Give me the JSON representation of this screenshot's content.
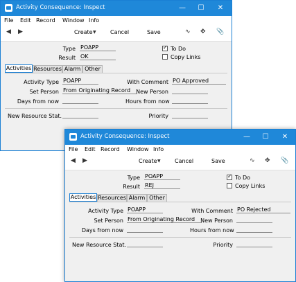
{
  "windows": [
    {
      "title": "Activity Consequence: Inspect",
      "menu": [
        "File",
        "Edit",
        "Record",
        "Window",
        "Info"
      ],
      "toolbar": {
        "create": "Create",
        "cancel": "Cancel",
        "save": "Save"
      },
      "header": {
        "type_label": "Type",
        "type_value": "POAPP",
        "result_label": "Result",
        "result_value": "OK",
        "todo_label": "To Do",
        "todo_checked": true,
        "copylinks_label": "Copy Links",
        "copylinks_checked": false
      },
      "tabs": [
        "Activities",
        "Resources",
        "Alarm",
        "Other"
      ],
      "fields": {
        "activity_type_label": "Activity Type",
        "activity_type_value": "POAPP",
        "with_comment_label": "With Comment",
        "with_comment_value": "PO Approved",
        "set_person_label": "Set Person",
        "set_person_value": "From Originating Record",
        "new_person_label": "New Person",
        "new_person_value": "",
        "days_label": "Days from now",
        "days_value": "",
        "hours_label": "Hours from now",
        "hours_value": "",
        "new_resource_label": "New Resource Stat.",
        "new_resource_value": "",
        "priority_label": "Priority",
        "priority_value": ""
      }
    },
    {
      "title": "Activity Consequence: Inspect",
      "menu": [
        "File",
        "Edit",
        "Record",
        "Window",
        "Info"
      ],
      "toolbar": {
        "create": "Create",
        "cancel": "Cancel",
        "save": "Save"
      },
      "header": {
        "type_label": "Type",
        "type_value": "POAPP",
        "result_label": "Result",
        "result_value": "REJ",
        "todo_label": "To Do",
        "todo_checked": true,
        "copylinks_label": "Copy Links",
        "copylinks_checked": false
      },
      "tabs": [
        "Activities",
        "Resources",
        "Alarm",
        "Other"
      ],
      "fields": {
        "activity_type_label": "Activity Type",
        "activity_type_value": "POAPP",
        "with_comment_label": "With Comment",
        "with_comment_value": "PO Rejected",
        "set_person_label": "Set Person",
        "set_person_value": "From Originating Record",
        "new_person_label": "New Person",
        "new_person_value": "",
        "days_label": "Days from now",
        "days_value": "",
        "hours_label": "Hours from now",
        "hours_value": "",
        "new_resource_label": "New Resource Stat.",
        "new_resource_value": "",
        "priority_label": "Priority",
        "priority_value": ""
      }
    }
  ],
  "colors": {
    "titlebar": "#1f88d9",
    "border": "#1a7fd4",
    "form_bg": "#f0f0f0"
  },
  "icons": [
    "app-icon",
    "minimize-icon",
    "maximize-icon",
    "close-icon",
    "prev-record-icon",
    "next-record-icon",
    "dropdown-arrow-icon",
    "activity-icon",
    "expand-icon",
    "attachment-icon"
  ]
}
